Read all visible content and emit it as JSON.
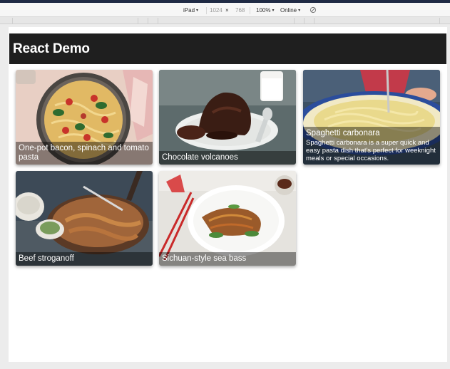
{
  "devtools": {
    "device": "iPad",
    "width": "1024",
    "times": "×",
    "height": "768",
    "zoom": "100%",
    "network": "Online",
    "caret": "▾",
    "rotate_icon": "rotate-icon"
  },
  "app": {
    "title": "React Demo"
  },
  "recipes": [
    {
      "title": "One-pot bacon, spinach and tomato pasta",
      "description": ""
    },
    {
      "title": "Chocolate volcanoes",
      "description": ""
    },
    {
      "title": "Spaghetti carbonara",
      "description": "Spaghetti carbonara is a super quick and easy pasta dish that's perfect for weeknight meals or special occasions."
    },
    {
      "title": "Beef stroganoff",
      "description": ""
    },
    {
      "title": "Sichuan-style sea bass",
      "description": ""
    }
  ],
  "colors": {
    "header_bg": "#1f1f1f",
    "caption_bg": "rgba(0,0,0,0.42)"
  }
}
